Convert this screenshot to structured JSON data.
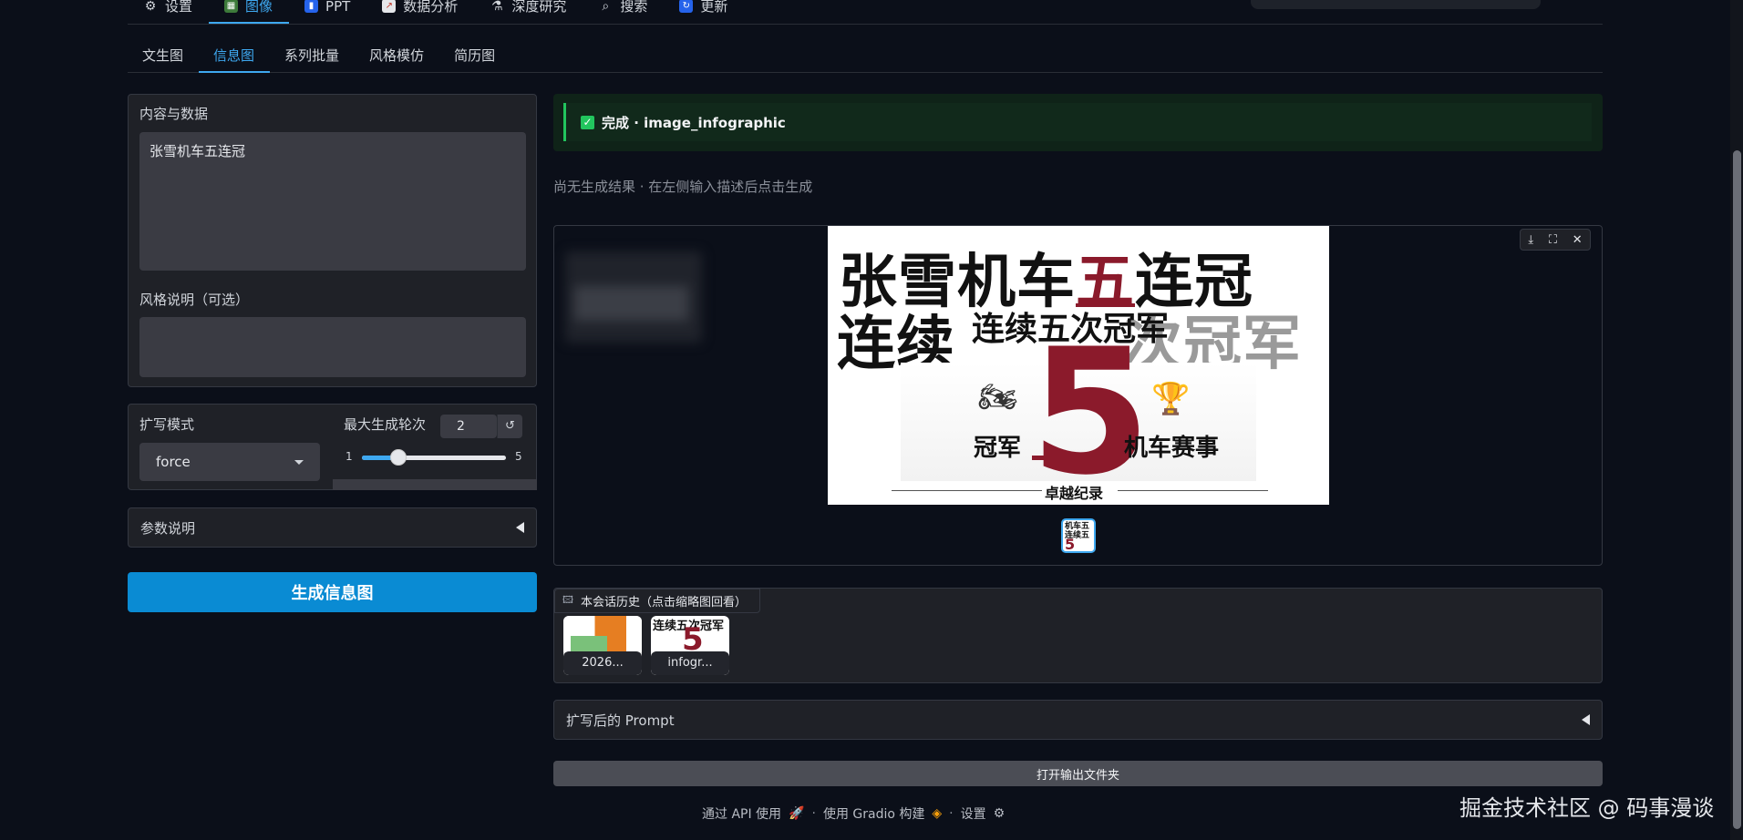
{
  "top_tabs": [
    {
      "icon": "gear-icon",
      "glyph": "⚙",
      "label": "设置"
    },
    {
      "icon": "image-icon",
      "glyph": "🖼",
      "label": "图像"
    },
    {
      "icon": "bar-chart-icon",
      "glyph": "📊",
      "label": "PPT"
    },
    {
      "icon": "line-chart-icon",
      "glyph": "📈",
      "label": "数据分析"
    },
    {
      "icon": "flask-icon",
      "glyph": "⚗",
      "label": "深度研究"
    },
    {
      "icon": "search-icon",
      "glyph": "🔍",
      "label": "搜索"
    },
    {
      "icon": "refresh-icon",
      "glyph": "↻",
      "label": "更新"
    }
  ],
  "sub_tabs": [
    "文生图",
    "信息图",
    "系列批量",
    "风格模仿",
    "简历图"
  ],
  "content": {
    "label": "内容与数据",
    "value": "张雪机车五连冠"
  },
  "style": {
    "label": "风格说明（可选）",
    "value": ""
  },
  "expand": {
    "label": "扩写模式",
    "value": "force"
  },
  "rounds": {
    "label": "最大生成轮次",
    "value": "2",
    "min": "1",
    "max": "5",
    "fraction": 0.25
  },
  "params_accordion": "参数说明",
  "generate_button": "生成信息图",
  "status": {
    "text": "完成 · image_infographic"
  },
  "empty_hint": "尚无生成结果 · 在左侧输入描述后点击生成",
  "poster": {
    "line1_a": "张雪机车",
    "line1_red": "五",
    "line1_b": "连冠",
    "line2_a": "连续",
    "line2_fade": "次冠军",
    "line2_overlay": "连续五次冠军",
    "big_number": "5",
    "caption_left": "冠军",
    "caption_right": "机车赛事",
    "footer": "卓越纪录"
  },
  "mini_thumb": {
    "text": "机车五连续五",
    "num": "5"
  },
  "history": {
    "title": "本会话历史（点击缩略图回看）",
    "items": [
      {
        "caption": "2026..."
      },
      {
        "caption": "infogr...",
        "text": "连续五次冠军",
        "num": "5"
      }
    ]
  },
  "prompt_accordion": "扩写后的 Prompt",
  "open_folder_button": "打开输出文件夹",
  "footer": {
    "api": "通过 API 使用",
    "gradio": "使用 Gradio 构建",
    "settings": "设置",
    "separator": "·"
  },
  "watermark": "掘金技术社区 @ 码事漫谈"
}
